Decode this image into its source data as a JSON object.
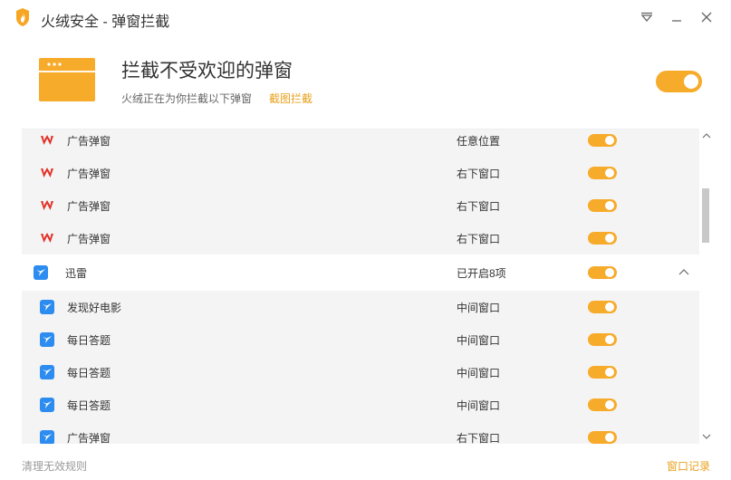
{
  "window": {
    "title": "火绒安全 - 弹窗拦截",
    "app_icon": "huorong-flame-icon",
    "controls": [
      "menu-triangle-icon",
      "minimize-icon",
      "close-icon"
    ]
  },
  "header": {
    "title": "拦截不受欢迎的弹窗",
    "subtitle": "火绒正在为你拦截以下弹窗",
    "link": "截图拦截",
    "icon": "popup-window-icon",
    "master_toggle": "on"
  },
  "colors": {
    "accent": "#f7ab2b",
    "link": "#e8a21d",
    "wps_red": "#e2332a",
    "xunlei_blue": "#2d8cf0",
    "list_bg": "#f4f4f4"
  },
  "list": {
    "rows": [
      {
        "type": "sub",
        "icon": "wps-icon",
        "name": "广告弹窗",
        "position": "任意位置",
        "toggle": "on"
      },
      {
        "type": "sub",
        "icon": "wps-icon",
        "name": "广告弹窗",
        "position": "右下窗口",
        "toggle": "on"
      },
      {
        "type": "sub",
        "icon": "wps-icon",
        "name": "广告弹窗",
        "position": "右下窗口",
        "toggle": "on"
      },
      {
        "type": "sub",
        "icon": "wps-icon",
        "name": "广告弹窗",
        "position": "右下窗口",
        "toggle": "on"
      },
      {
        "type": "group",
        "icon": "xunlei-icon",
        "name": "迅雷",
        "position": "已开启8项",
        "toggle": "on",
        "expanded": true
      },
      {
        "type": "sub",
        "icon": "xunlei-icon",
        "name": "发现好电影",
        "position": "中间窗口",
        "toggle": "on"
      },
      {
        "type": "sub",
        "icon": "xunlei-icon",
        "name": "每日答题",
        "position": "中间窗口",
        "toggle": "on"
      },
      {
        "type": "sub",
        "icon": "xunlei-icon",
        "name": "每日答题",
        "position": "中间窗口",
        "toggle": "on"
      },
      {
        "type": "sub",
        "icon": "xunlei-icon",
        "name": "每日答题",
        "position": "中间窗口",
        "toggle": "on"
      },
      {
        "type": "sub",
        "icon": "xunlei-icon",
        "name": "广告弹窗",
        "position": "右下窗口",
        "toggle": "on"
      }
    ]
  },
  "footer": {
    "left": "清理无效规则",
    "right": "窗口记录"
  }
}
